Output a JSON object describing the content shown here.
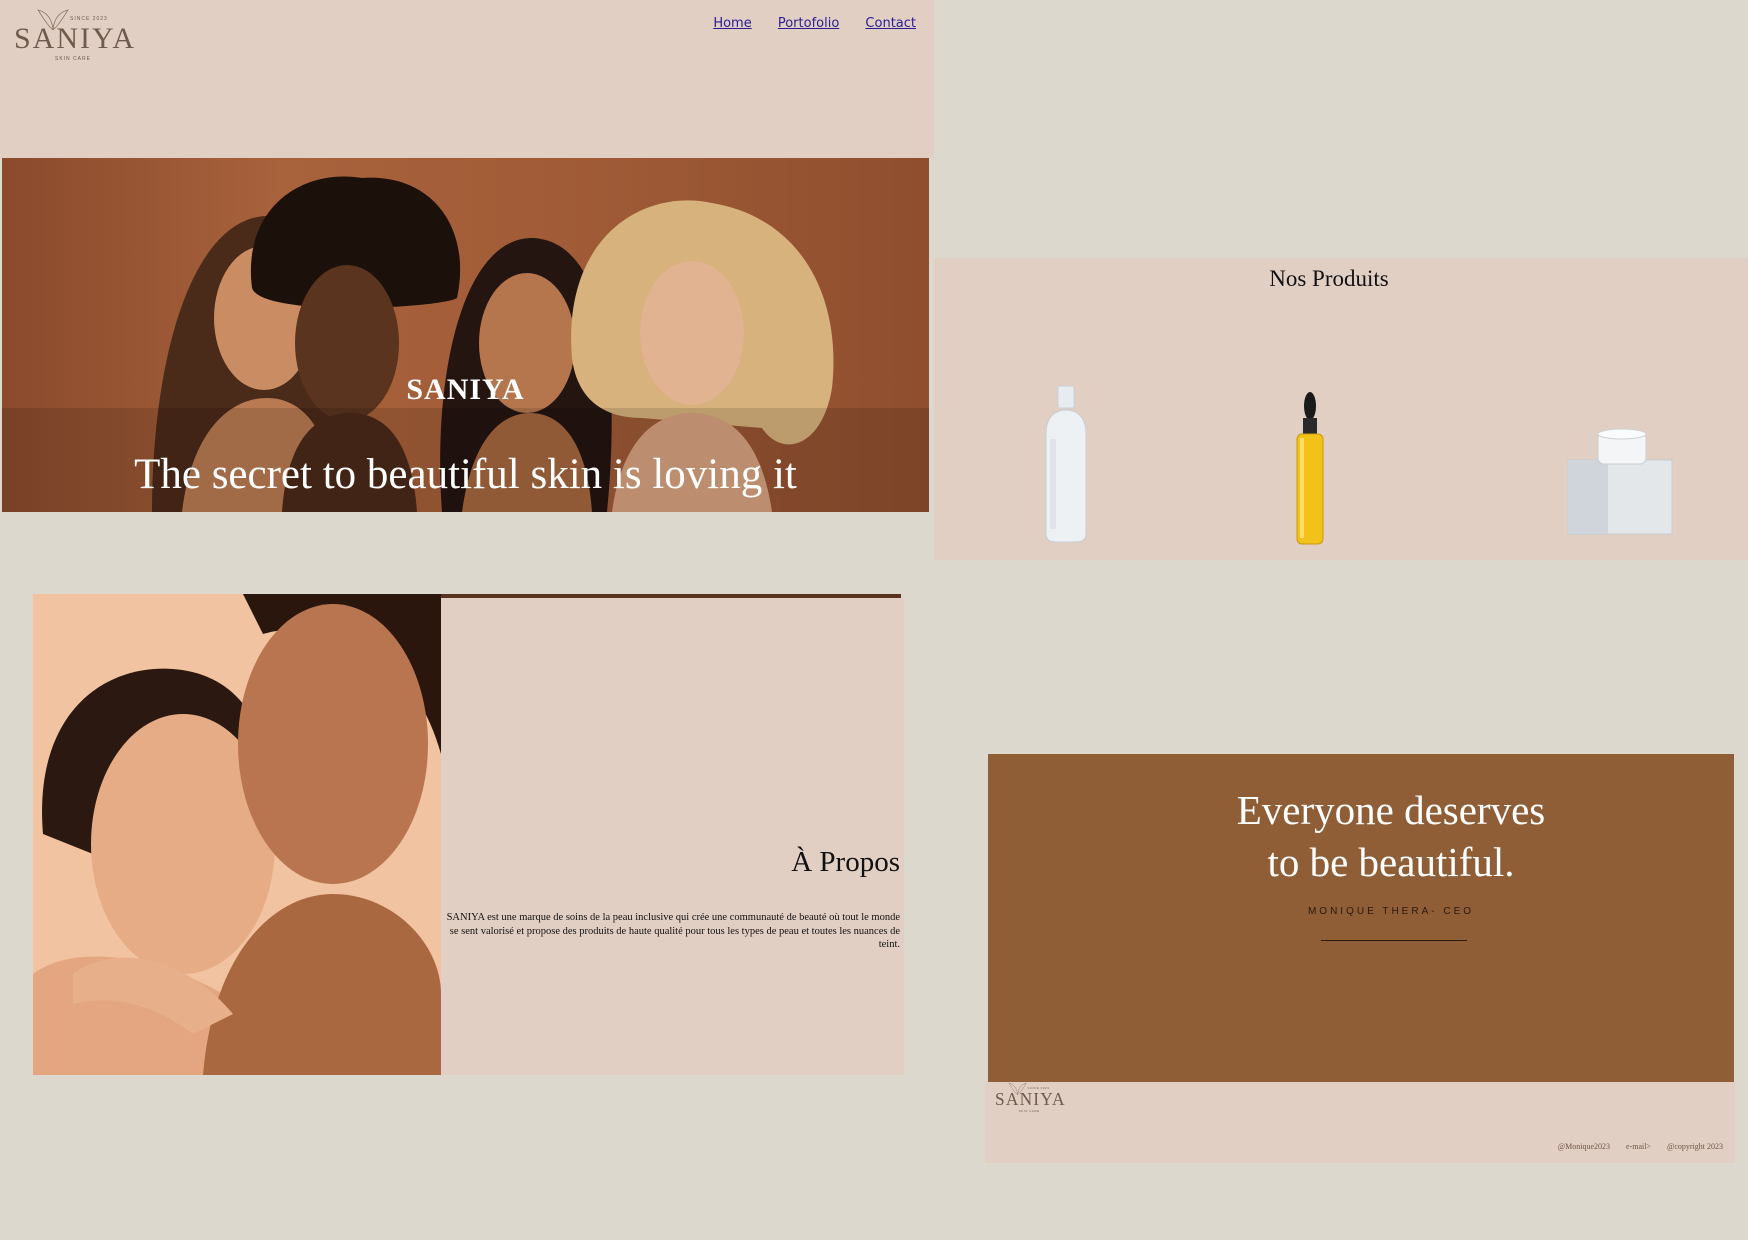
{
  "header": {
    "logo": {
      "since": "SINCE 2023",
      "word": "SANIYA",
      "sub": "SKIN CARE"
    },
    "nav": [
      {
        "label": "Home"
      },
      {
        "label": "Portofolio"
      },
      {
        "label": "Contact"
      }
    ]
  },
  "hero": {
    "brand": "SANIYA",
    "tagline": "The secret to beautiful skin is loving it"
  },
  "about": {
    "title": "À Propos",
    "text": "SANIYA est une marque de soins de la peau inclusive qui crée une communauté de beauté où tout le monde se sent valorisé et propose des produits de haute qualité pour tous les types de peau et toutes les nuances de teint."
  },
  "products": {
    "title": "Nos Produits",
    "items": [
      {
        "icon": "lotion-bottle-icon"
      },
      {
        "icon": "serum-dropper-icon"
      },
      {
        "icon": "cream-jar-icon"
      }
    ]
  },
  "quote": {
    "line1": "Everyone deserves",
    "line2": "to be beautiful.",
    "author": "MONIQUE THERA- CEO"
  },
  "footer": {
    "logo": {
      "since": "SINCE 2023",
      "word": "SANIYA",
      "sub": "SKIN CARE"
    },
    "links": [
      "@Monique2023",
      "e-mail>",
      "@copyright 2023"
    ]
  },
  "colors": {
    "page_bg": "#ddd8ce",
    "panel_pink": "#e2cfc4",
    "brown": "#8f5d36",
    "nav_link": "#2a1d8f"
  }
}
